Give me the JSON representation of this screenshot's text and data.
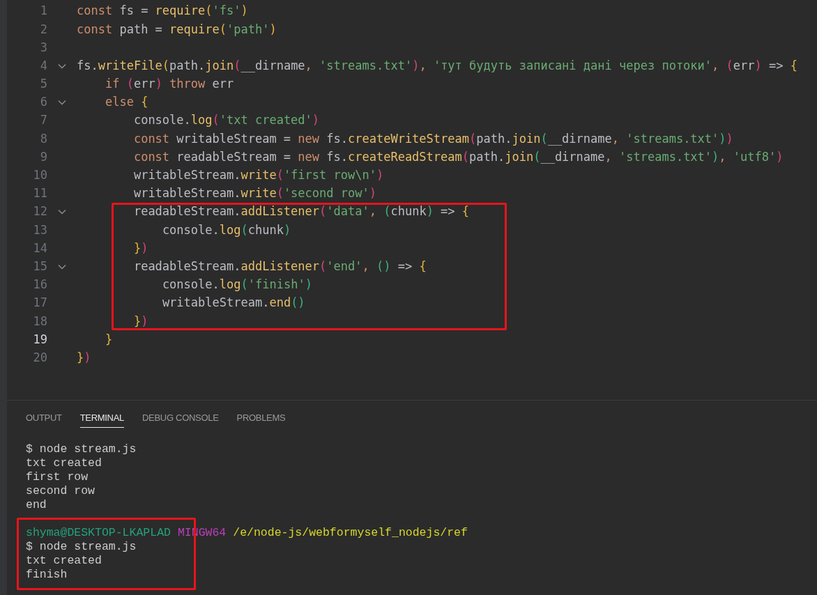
{
  "editor": {
    "lines": [
      {
        "kind": "line",
        "number": "1",
        "current": false,
        "tokens": [
          {
            "kind": "kw",
            "text": "const"
          },
          {
            "kind": "id",
            "text": " fs = "
          },
          {
            "kind": "fn",
            "text": "require"
          },
          {
            "kind": "b1",
            "text": "("
          },
          {
            "kind": "str",
            "text": "'fs'"
          },
          {
            "kind": "b1",
            "text": ")"
          }
        ]
      },
      {
        "kind": "line",
        "number": "2",
        "current": false,
        "tokens": [
          {
            "kind": "kw",
            "text": "const"
          },
          {
            "kind": "id",
            "text": " path = "
          },
          {
            "kind": "fn",
            "text": "require"
          },
          {
            "kind": "b1",
            "text": "("
          },
          {
            "kind": "str",
            "text": "'path'"
          },
          {
            "kind": "b1",
            "text": ")"
          }
        ]
      },
      {
        "kind": "line",
        "number": "3",
        "current": false
      },
      {
        "kind": "line",
        "number": "4",
        "current": false,
        "tokens": [
          {
            "kind": "id",
            "text": "fs."
          },
          {
            "kind": "fn",
            "text": "writeFile"
          },
          {
            "kind": "b1",
            "text": "("
          },
          {
            "kind": "id",
            "text": "path."
          },
          {
            "kind": "fn",
            "text": "join"
          },
          {
            "kind": "b2",
            "text": "("
          },
          {
            "kind": "id",
            "text": "__dirname"
          },
          {
            "kind": "kw",
            "text": ", "
          },
          {
            "kind": "str",
            "text": "'streams.txt'"
          },
          {
            "kind": "b2",
            "text": ")"
          },
          {
            "kind": "kw",
            "text": ", "
          },
          {
            "kind": "str",
            "text": "'тут будуть записані дані через потоки'"
          },
          {
            "kind": "kw",
            "text": ", "
          },
          {
            "kind": "b2",
            "text": "("
          },
          {
            "kind": "id",
            "text": "err"
          },
          {
            "kind": "b2",
            "text": ")"
          },
          {
            "kind": "id",
            "text": " => "
          },
          {
            "kind": "b1",
            "text": "{"
          }
        ],
        "children": [
          {
            "kind": "line",
            "number": "5",
            "current": false,
            "tokens": [
              {
                "kind": "kw",
                "text": "if "
              },
              {
                "kind": "b2",
                "text": "("
              },
              {
                "kind": "id",
                "text": "err"
              },
              {
                "kind": "b2",
                "text": ")"
              },
              {
                "kind": "kw",
                "text": " throw"
              },
              {
                "kind": "id",
                "text": " err"
              }
            ]
          },
          {
            "kind": "line",
            "number": "6",
            "current": false,
            "tokens": [
              {
                "kind": "kw",
                "text": "else "
              },
              {
                "kind": "b1",
                "text": "{"
              }
            ],
            "children": [
              {
                "kind": "line",
                "number": "7",
                "current": false,
                "tokens": [
                  {
                    "kind": "id",
                    "text": "console."
                  },
                  {
                    "kind": "fn",
                    "text": "log"
                  },
                  {
                    "kind": "b2",
                    "text": "("
                  },
                  {
                    "kind": "str",
                    "text": "'txt created'"
                  },
                  {
                    "kind": "b2",
                    "text": ")"
                  }
                ]
              },
              {
                "kind": "line",
                "number": "8",
                "current": false,
                "tokens": [
                  {
                    "kind": "kw",
                    "text": "const"
                  },
                  {
                    "kind": "id",
                    "text": " writableStream = "
                  },
                  {
                    "kind": "kw",
                    "text": "new"
                  },
                  {
                    "kind": "id",
                    "text": " fs."
                  },
                  {
                    "kind": "fn",
                    "text": "createWriteStream"
                  },
                  {
                    "kind": "b2",
                    "text": "("
                  },
                  {
                    "kind": "id",
                    "text": "path."
                  },
                  {
                    "kind": "fn",
                    "text": "join"
                  },
                  {
                    "kind": "b3",
                    "text": "("
                  },
                  {
                    "kind": "id",
                    "text": "__dirname"
                  },
                  {
                    "kind": "kw",
                    "text": ", "
                  },
                  {
                    "kind": "str",
                    "text": "'streams.txt'"
                  },
                  {
                    "kind": "b3",
                    "text": ")"
                  },
                  {
                    "kind": "b2",
                    "text": ")"
                  }
                ]
              },
              {
                "kind": "line",
                "number": "9",
                "current": false,
                "tokens": [
                  {
                    "kind": "kw",
                    "text": "const"
                  },
                  {
                    "kind": "id",
                    "text": " readableStream = "
                  },
                  {
                    "kind": "kw",
                    "text": "new"
                  },
                  {
                    "kind": "id",
                    "text": " fs."
                  },
                  {
                    "kind": "fn",
                    "text": "createReadStream"
                  },
                  {
                    "kind": "b2",
                    "text": "("
                  },
                  {
                    "kind": "id",
                    "text": "path."
                  },
                  {
                    "kind": "fn",
                    "text": "join"
                  },
                  {
                    "kind": "b3",
                    "text": "("
                  },
                  {
                    "kind": "id",
                    "text": "__dirname"
                  },
                  {
                    "kind": "kw",
                    "text": ", "
                  },
                  {
                    "kind": "str",
                    "text": "'streams.txt'"
                  },
                  {
                    "kind": "b3",
                    "text": ")"
                  },
                  {
                    "kind": "kw",
                    "text": ", "
                  },
                  {
                    "kind": "str",
                    "text": "'utf8'"
                  },
                  {
                    "kind": "b2",
                    "text": ")"
                  }
                ]
              },
              {
                "kind": "line",
                "number": "10",
                "current": false,
                "tokens": [
                  {
                    "kind": "id",
                    "text": "writableStream."
                  },
                  {
                    "kind": "fn",
                    "text": "write"
                  },
                  {
                    "kind": "b2",
                    "text": "("
                  },
                  {
                    "kind": "str",
                    "text": "'first row\\n'"
                  },
                  {
                    "kind": "b2",
                    "text": ")"
                  }
                ]
              },
              {
                "kind": "line",
                "number": "11",
                "current": false,
                "tokens": [
                  {
                    "kind": "id",
                    "text": "writableStream."
                  },
                  {
                    "kind": "fn",
                    "text": "write"
                  },
                  {
                    "kind": "b2",
                    "text": "("
                  },
                  {
                    "kind": "str",
                    "text": "'second row'"
                  },
                  {
                    "kind": "b2",
                    "text": ")"
                  }
                ]
              },
              {
                "kind": "frame",
                "lines": [
                  {
                    "kind": "line",
                    "number": "12",
                    "current": false,
                    "tokens": [
                      {
                        "kind": "id",
                        "text": "readableStream."
                      },
                      {
                        "kind": "fn",
                        "text": "addListener"
                      },
                      {
                        "kind": "b2",
                        "text": "("
                      },
                      {
                        "kind": "str",
                        "text": "'data'"
                      },
                      {
                        "kind": "kw",
                        "text": ", "
                      },
                      {
                        "kind": "b3",
                        "text": "("
                      },
                      {
                        "kind": "id",
                        "text": "chunk"
                      },
                      {
                        "kind": "b3",
                        "text": ")"
                      },
                      {
                        "kind": "id",
                        "text": " => "
                      },
                      {
                        "kind": "b1",
                        "text": "{"
                      }
                    ],
                    "children": [
                      {
                        "kind": "line",
                        "number": "13",
                        "current": false,
                        "tokens": [
                          {
                            "kind": "id",
                            "text": "console."
                          },
                          {
                            "kind": "fn",
                            "text": "log"
                          },
                          {
                            "kind": "b3",
                            "text": "("
                          },
                          {
                            "kind": "id",
                            "text": "chunk"
                          },
                          {
                            "kind": "b3",
                            "text": ")"
                          }
                        ]
                      }
                    ]
                  },
                  {
                    "kind": "line",
                    "number": "14",
                    "current": false,
                    "tokens": [
                      {
                        "kind": "b1",
                        "text": "}"
                      },
                      {
                        "kind": "b2",
                        "text": ")"
                      }
                    ]
                  },
                  {
                    "kind": "line",
                    "number": "15",
                    "current": false,
                    "tokens": [
                      {
                        "kind": "id",
                        "text": "readableStream."
                      },
                      {
                        "kind": "fn",
                        "text": "addListener"
                      },
                      {
                        "kind": "b2",
                        "text": "("
                      },
                      {
                        "kind": "str",
                        "text": "'end'"
                      },
                      {
                        "kind": "kw",
                        "text": ", "
                      },
                      {
                        "kind": "b3",
                        "text": "()"
                      },
                      {
                        "kind": "id",
                        "text": " => "
                      },
                      {
                        "kind": "b1",
                        "text": "{"
                      }
                    ],
                    "children": [
                      {
                        "kind": "line",
                        "number": "16",
                        "current": false,
                        "tokens": [
                          {
                            "kind": "id",
                            "text": "console."
                          },
                          {
                            "kind": "fn",
                            "text": "log"
                          },
                          {
                            "kind": "b3",
                            "text": "("
                          },
                          {
                            "kind": "str",
                            "text": "'finish'"
                          },
                          {
                            "kind": "b3",
                            "text": ")"
                          }
                        ]
                      },
                      {
                        "kind": "line",
                        "number": "17",
                        "current": false,
                        "tokens": [
                          {
                            "kind": "id",
                            "text": "writableStream."
                          },
                          {
                            "kind": "fn",
                            "text": "end"
                          },
                          {
                            "kind": "b3",
                            "text": "()"
                          }
                        ]
                      }
                    ]
                  },
                  {
                    "kind": "line",
                    "number": "18",
                    "current": false,
                    "tokens": [
                      {
                        "kind": "b1",
                        "text": "}"
                      },
                      {
                        "kind": "b2",
                        "text": ")"
                      }
                    ]
                  }
                ]
              }
            ]
          },
          {
            "kind": "line",
            "number": "19",
            "current": true,
            "tokens": [
              {
                "kind": "b1",
                "text": "}"
              }
            ]
          }
        ]
      },
      {
        "kind": "line",
        "number": "20",
        "current": false,
        "tokens": [
          {
            "kind": "b1",
            "text": "}"
          },
          {
            "kind": "b2",
            "text": ")"
          }
        ]
      }
    ]
  },
  "panel": {
    "tabs": [
      {
        "label": "OUTPUT",
        "selected": false
      },
      {
        "label": "TERMINAL",
        "selected": true
      },
      {
        "label": "DEBUG CONSOLE",
        "selected": false
      },
      {
        "label": "PROBLEMS",
        "selected": false
      }
    ]
  },
  "terminal": {
    "lines": [
      {
        "kind": "line",
        "segments": [
          {
            "kind": "plain",
            "text": "$ node stream.js"
          }
        ]
      },
      {
        "kind": "line",
        "segments": [
          {
            "kind": "plain",
            "text": "txt created"
          }
        ]
      },
      {
        "kind": "line",
        "segments": [
          {
            "kind": "plain",
            "text": "first row"
          }
        ]
      },
      {
        "kind": "line",
        "segments": [
          {
            "kind": "plain",
            "text": "second row"
          }
        ]
      },
      {
        "kind": "line",
        "segments": [
          {
            "kind": "plain",
            "text": "end"
          }
        ]
      },
      {
        "kind": "frame",
        "lines": [
          {
            "kind": "line",
            "segments": [
              {
                "kind": "user",
                "text": "shyma@DESKTOP-LKAPLAD"
              },
              {
                "kind": "system",
                "text": "MINGW64"
              },
              {
                "kind": "path",
                "text": "/e/node-js/webformyself_nodejs/ref"
              }
            ]
          },
          {
            "kind": "line",
            "segments": [
              {
                "kind": "plain",
                "text": "$ node stream.js"
              }
            ]
          },
          {
            "kind": "line",
            "segments": [
              {
                "kind": "plain",
                "text": "txt created"
              }
            ]
          },
          {
            "kind": "line",
            "segments": [
              {
                "kind": "plain",
                "text": "finish"
              }
            ]
          }
        ]
      }
    ]
  }
}
